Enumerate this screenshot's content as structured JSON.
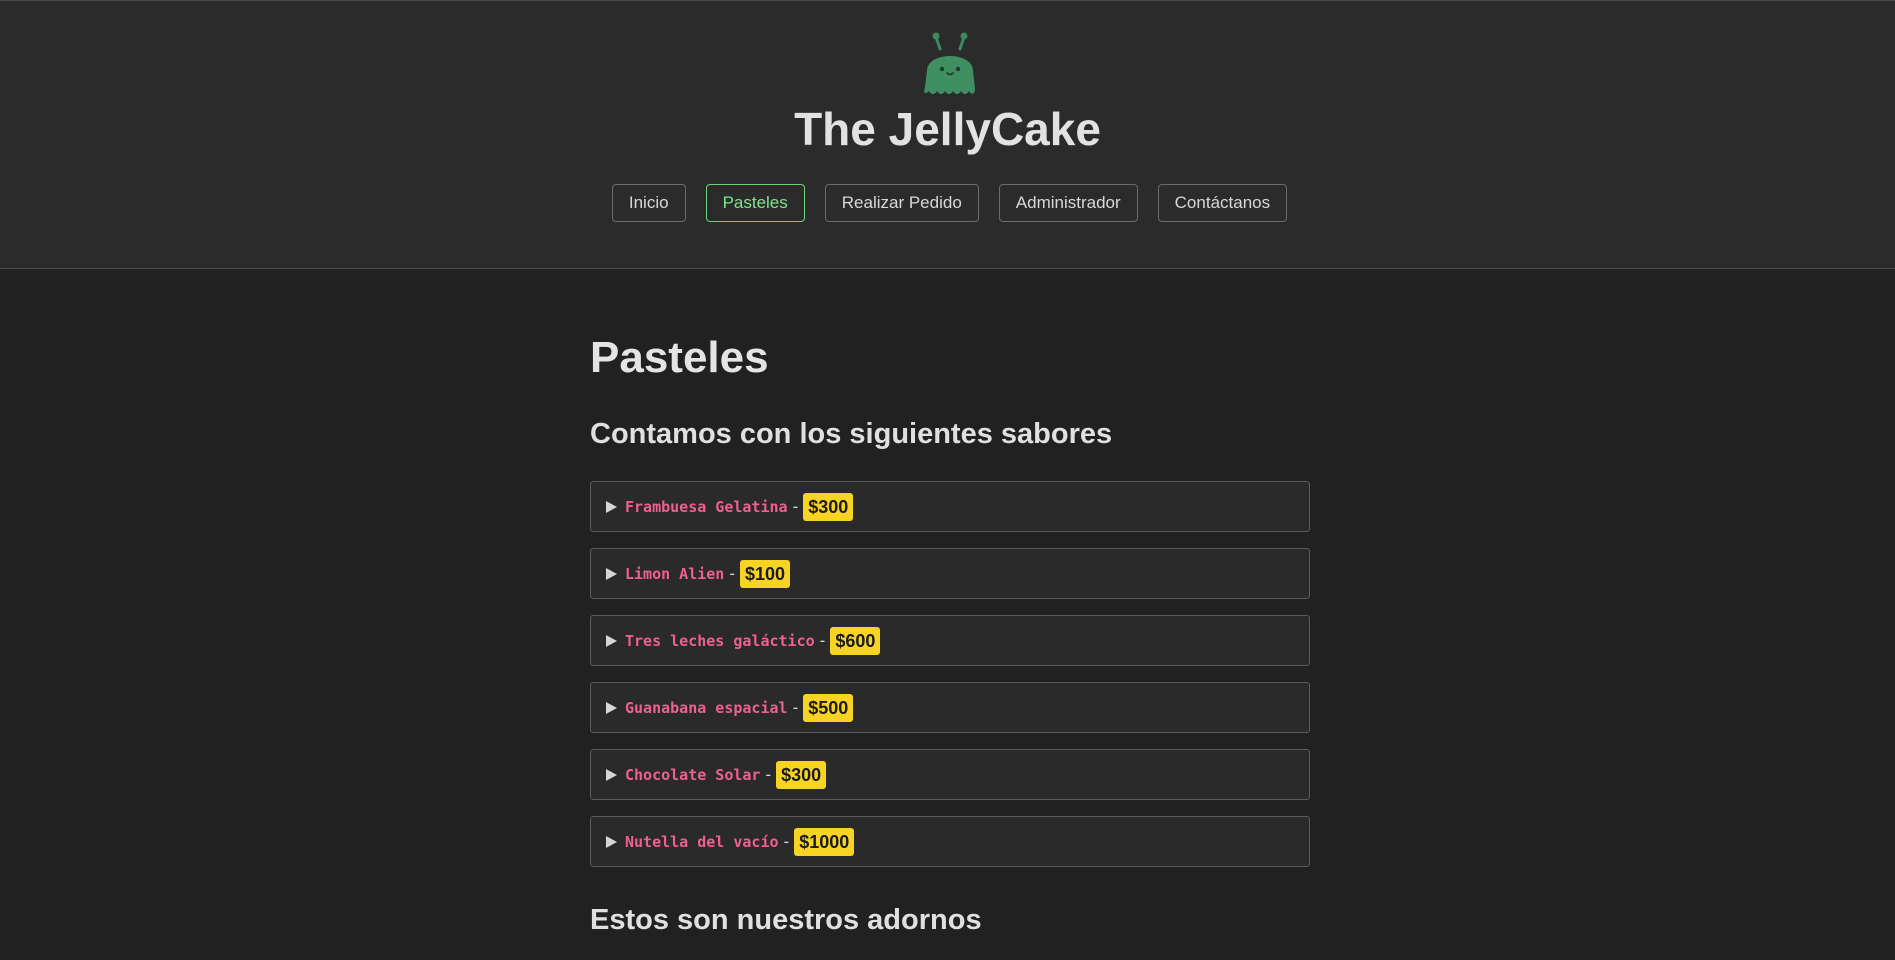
{
  "header": {
    "title": "The JellyCake",
    "logo_icon": "green-alien-jelly-logo"
  },
  "nav": {
    "items": [
      {
        "label": "Inicio"
      },
      {
        "label": "Pasteles"
      },
      {
        "label": "Realizar Pedido"
      },
      {
        "label": "Administrador"
      },
      {
        "label": "Contáctanos"
      }
    ],
    "active": "Pasteles"
  },
  "main": {
    "heading": "Pasteles",
    "flavors_heading": "Contamos con los siguientes sabores",
    "flavors": [
      {
        "name": "Frambuesa Gelatina",
        "price": "$300"
      },
      {
        "name": "Limon Alien",
        "price": "$100"
      },
      {
        "name": "Tres leches galáctico",
        "price": "$600"
      },
      {
        "name": "Guanabana espacial",
        "price": "$500"
      },
      {
        "name": "Chocolate Solar",
        "price": "$300"
      },
      {
        "name": "Nutella del vacío",
        "price": "$1000"
      }
    ],
    "separator": "-",
    "decorations_heading": "Estos son nuestros adornos"
  },
  "colors": {
    "background": "#212121",
    "header_background": "#2b2b2b",
    "active_nav": "#7ee58a",
    "flavor_name": "#f0608e",
    "price_badge": "#f7d424",
    "logo_green": "#3f8f63"
  }
}
